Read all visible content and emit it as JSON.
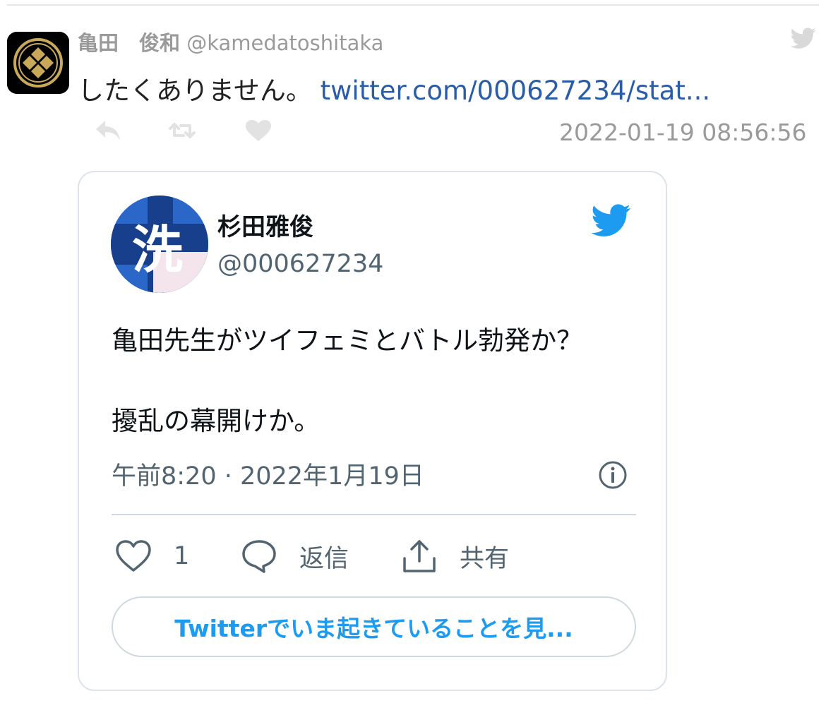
{
  "tweet": {
    "display_name": "亀田　俊和",
    "handle": "@kamedatoshitaka",
    "text": "したくありません。",
    "link": "twitter.com/000627234/stat...",
    "timestamp": "2022-01-19 08:56:56",
    "actions": [
      "reply-icon",
      "retweet-icon",
      "like-icon"
    ]
  },
  "embed": {
    "author_name": "杉田雅俊",
    "author_handle": "@000627234",
    "text_line1": "亀田先生がツイフェミとバトル勃発か？",
    "text_line2": "擾乱の幕開けか。",
    "date": "午前8:20 · 2022年1月19日",
    "like_count": "1",
    "reply_label": "返信",
    "share_label": "共有",
    "cta_label": "Twitterでいま起きていることを見...",
    "avatar_glyph": "洗"
  },
  "colors": {
    "link": "#2a5ca8",
    "twitter_blue": "#1d9bf0",
    "muted": "#9a9a9a",
    "secondary_text": "#536471"
  }
}
